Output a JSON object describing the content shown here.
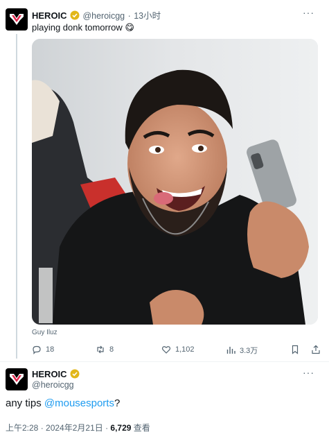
{
  "tweet1": {
    "display_name": "HEROIC",
    "handle": "@heroicgg",
    "separator": "·",
    "time_ago": "13小时",
    "text": "playing donk tomorrow",
    "emoji": "😋",
    "more": "···",
    "photo_credit": "Guy Iluz",
    "replies": "18",
    "reposts": "8",
    "likes": "1,102",
    "views": "3.3万"
  },
  "tweet2": {
    "display_name": "HEROIC",
    "handle": "@heroicgg",
    "more": "···",
    "text_prefix": "any tips ",
    "mention": "@mousesports",
    "text_suffix": "?",
    "timestamp": "上午2:28 · 2024年2月21日 · ",
    "view_count": "6,729",
    "view_label": " 查看"
  },
  "colors": {
    "accent": "#1d9bf0",
    "verified": "#e2b719",
    "secondary_text": "#536471"
  }
}
